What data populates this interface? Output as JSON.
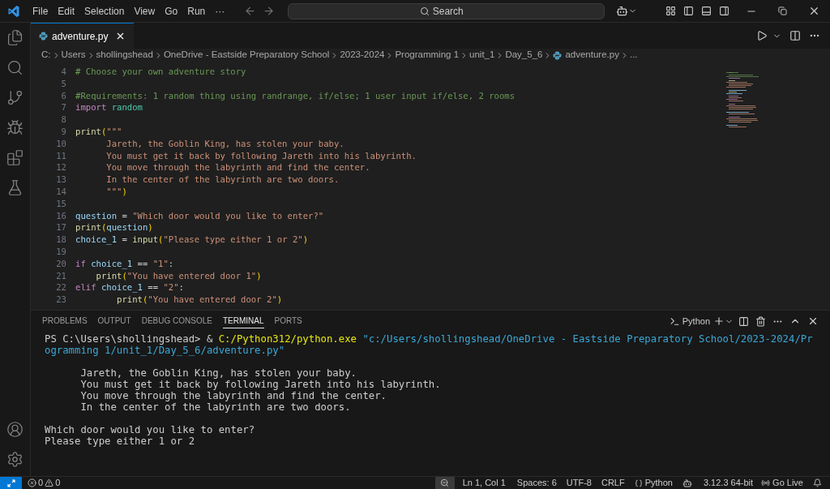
{
  "menu": [
    "File",
    "Edit",
    "Selection",
    "View",
    "Go",
    "Run",
    "···"
  ],
  "search": {
    "placeholder": "Search"
  },
  "tabs": [
    {
      "label": "adventure.py",
      "selected": true
    }
  ],
  "breadcrumbs": [
    "C:",
    "Users",
    "shollingshead",
    "OneDrive - Eastside Preparatory School",
    "2023-2024",
    "Programming 1",
    "unit_1",
    "Day_5_6",
    "adventure.py",
    "..."
  ],
  "code_lines": [
    {
      "n": "4",
      "tokens": [
        {
          "kind": "comment",
          "text": "# Choose your own adventure story"
        }
      ]
    },
    {
      "n": "5"
    },
    {
      "n": "6",
      "tokens": [
        {
          "kind": "comment",
          "text": "#Requirements: 1 random thing using randrange, if/else; 1 user input if/else, 2 rooms"
        }
      ]
    },
    {
      "n": "7",
      "tokens": [
        {
          "kind": "keyword",
          "text": "import"
        },
        {
          "kind": "module",
          "text": " random"
        }
      ]
    },
    {
      "n": "8"
    },
    {
      "n": "9",
      "tokens": [
        {
          "kind": "func",
          "text": "print"
        },
        {
          "kind": "paren",
          "text": "("
        },
        {
          "kind": "string",
          "text": "\"\"\""
        }
      ]
    },
    {
      "n": "10",
      "tokens": [
        {
          "kind": "string",
          "text": "      Jareth, the Goblin King, has stolen your baby."
        }
      ]
    },
    {
      "n": "11",
      "tokens": [
        {
          "kind": "string",
          "text": "      You must get it back by following Jareth into his labyrinth."
        }
      ]
    },
    {
      "n": "12",
      "tokens": [
        {
          "kind": "string",
          "text": "      You move through the labyrinth and find the center."
        }
      ]
    },
    {
      "n": "13",
      "tokens": [
        {
          "kind": "string",
          "text": "      In the center of the labyrinth are two doors."
        }
      ]
    },
    {
      "n": "14",
      "tokens": [
        {
          "kind": "string",
          "text": "      \"\"\""
        },
        {
          "kind": "paren",
          "text": ")"
        }
      ]
    },
    {
      "n": "15"
    },
    {
      "n": "16",
      "tokens": [
        {
          "kind": "var",
          "text": "question"
        },
        {
          "kind": "plain",
          "text": " = "
        },
        {
          "kind": "string",
          "text": "\"Which door would you like to enter?\""
        }
      ]
    },
    {
      "n": "17",
      "tokens": [
        {
          "kind": "func",
          "text": "print"
        },
        {
          "kind": "paren",
          "text": "("
        },
        {
          "kind": "var",
          "text": "question"
        },
        {
          "kind": "paren",
          "text": ")"
        }
      ]
    },
    {
      "n": "18",
      "tokens": [
        {
          "kind": "var",
          "text": "choice_1"
        },
        {
          "kind": "plain",
          "text": " = "
        },
        {
          "kind": "func",
          "text": "input"
        },
        {
          "kind": "paren",
          "text": "("
        },
        {
          "kind": "string",
          "text": "\"Please type either 1 or 2\""
        },
        {
          "kind": "paren",
          "text": ")"
        }
      ]
    },
    {
      "n": "19"
    },
    {
      "n": "20",
      "tokens": [
        {
          "kind": "keyword",
          "text": "if"
        },
        {
          "kind": "var",
          "text": " choice_1"
        },
        {
          "kind": "plain",
          "text": " == "
        },
        {
          "kind": "string",
          "text": "\"1\""
        },
        {
          "kind": "plain",
          "text": ":"
        }
      ]
    },
    {
      "n": "21",
      "tokens": [
        {
          "kind": "func",
          "text": "    print"
        },
        {
          "kind": "paren",
          "text": "("
        },
        {
          "kind": "string",
          "text": "\"You have entered door 1\""
        },
        {
          "kind": "paren",
          "text": ")"
        }
      ]
    },
    {
      "n": "22",
      "tokens": [
        {
          "kind": "keyword",
          "text": "elif"
        },
        {
          "kind": "var",
          "text": " choice_1"
        },
        {
          "kind": "plain",
          "text": " == "
        },
        {
          "kind": "string",
          "text": "\"2\""
        },
        {
          "kind": "plain",
          "text": ":"
        }
      ]
    },
    {
      "n": "23",
      "tokens": [
        {
          "kind": "func",
          "text": "        print"
        },
        {
          "kind": "paren",
          "text": "("
        },
        {
          "kind": "string",
          "text": "\"You have entered door 2\""
        },
        {
          "kind": "paren",
          "text": ")"
        }
      ]
    }
  ],
  "panel_tabs": [
    {
      "label": "PROBLEMS",
      "selected": false
    },
    {
      "label": "OUTPUT",
      "selected": false
    },
    {
      "label": "DEBUG CONSOLE",
      "selected": false
    },
    {
      "label": "TERMINAL",
      "selected": true
    },
    {
      "label": "PORTS",
      "selected": false
    }
  ],
  "terminal_profile": "Python",
  "terminal": {
    "prompt": "PS C:\\Users\\shollingshead> & ",
    "exe": "C:/Python312/python.exe",
    "arg": " \"c:/Users/shollingshead/OneDrive - Eastside Preparatory School/2023-2024/Programming 1/unit_1/Day_5_6/adventure.py\"",
    "output_blocks": [
      [
        "      Jareth, the Goblin King, has stolen your baby.",
        "      You must get it back by following Jareth into his labyrinth.",
        "      You move through the labyrinth and find the center.",
        "      In the center of the labyrinth are two doors."
      ],
      [
        "Which door would you like to enter?",
        "Please type either 1 or 2"
      ]
    ]
  },
  "status": {
    "errors": "0",
    "warnings": "0",
    "position": "Ln 1, Col 1",
    "spaces": "Spaces: 6",
    "encoding": "UTF-8",
    "eol": "CRLF",
    "language": "Python",
    "interpreter": "3.12.3 64-bit",
    "live": "Go Live"
  }
}
